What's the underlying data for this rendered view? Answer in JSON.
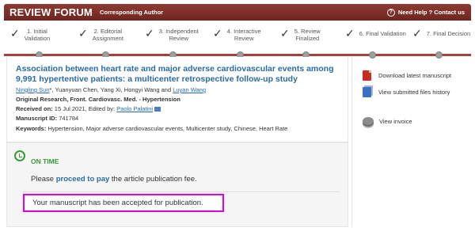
{
  "header": {
    "brand": "REVIEW FORUM",
    "role": "Corresponding Author",
    "help": "Need Help ? Contact us",
    "help_icon": "question-circle-icon"
  },
  "steps": [
    {
      "line1": "1. Initial",
      "line2": "Validation"
    },
    {
      "line1": "2. Editorial",
      "line2": "Assignment"
    },
    {
      "line1": "3. Independent",
      "line2": "Review"
    },
    {
      "line1": "4. Interactive",
      "line2": "Review"
    },
    {
      "line1": "5. Review",
      "line2": "Finalized"
    },
    {
      "line1": "6. Final Validation",
      "line2": ""
    },
    {
      "line1": "7. Final Decision",
      "line2": ""
    }
  ],
  "manuscript": {
    "title": "Association between heart rate and major adverse cardiovascular events among 9,991 hypertentive patients: a multicenter retrospective follow-up study",
    "author_1": "Ningling Sun",
    "author_1_mark": "*",
    "authors_mid": ", Yuanyuan Chen, Yang Xi, Hongyi Wang and",
    "author_last": "Luyan Wang",
    "article_type": "Original Research, Front. Cardiovasc. Med. - Hypertension",
    "received_label": "Received on:",
    "received_text": "15 Jul 2021, Edited by:",
    "editor": "Paolo Palatini",
    "id_label": "Manuscript ID:",
    "id_value": "741784",
    "keywords_label": "Keywords:",
    "keywords_value": "Hypertension, Major adverse cardiovascular events, Multicenter study, Chinese, Heart Rate"
  },
  "sidebar": {
    "download": "Download latest manuscript",
    "files": "View submitted files history",
    "invoice": "View invoice"
  },
  "status": {
    "label": "ON TIME",
    "pay_prefix": "Please",
    "pay_link": "proceed to pay",
    "pay_suffix": "the article publication fee.",
    "accepted": "Your manuscript has been accepted for publication."
  },
  "colors": {
    "header": "#7a2c26",
    "timeline": "#a4423b",
    "link": "#2a6aa6",
    "ontime": "#3a9a3a",
    "highlight": "#e100e1"
  }
}
